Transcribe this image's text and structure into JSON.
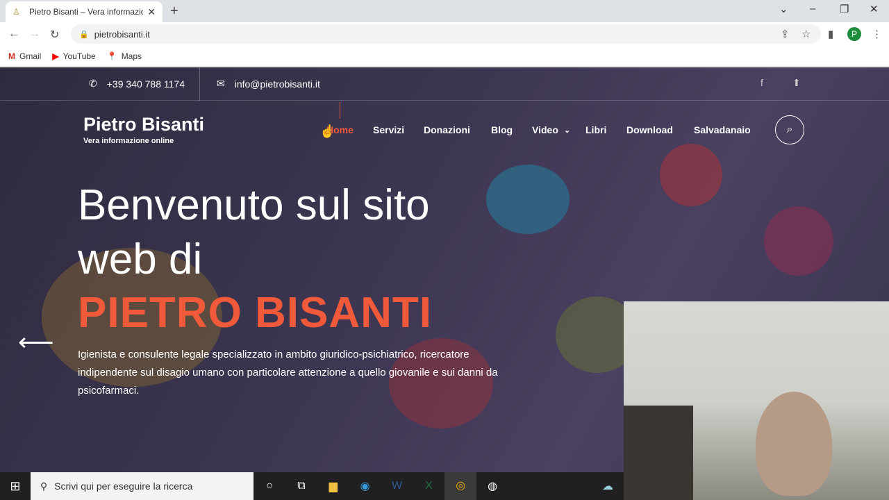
{
  "browser": {
    "tab_title": "Pietro Bisanti – Vera informazione online",
    "url": "pietrobisanti.it",
    "profile_initial": "P",
    "bookmarks": [
      "Gmail",
      "YouTube",
      "Maps"
    ]
  },
  "site": {
    "phone": "+39 340 788 1174",
    "email": "info@pietrobisanti.it",
    "logo_name": "Pietro Bisanti",
    "logo_tagline": "Vera informazione online",
    "menu": [
      "Home",
      "Servizi",
      "Donazioni",
      "Blog",
      "Video",
      "Libri",
      "Download",
      "Salvadanaio"
    ],
    "hero_line1": "Benvenuto sul sito",
    "hero_line2": "web di",
    "hero_name": "PIETRO BISANTI",
    "hero_desc": "Igienista e consulente legale specializzato in ambito giuridico-psichiatrico, ricercatore indipendente sul disagio umano con particolare attenzione a quello giovanile e sui danni da psicofarmaci.",
    "accent": "#f05a3a"
  },
  "taskbar": {
    "search_placeholder": "Scrivi qui per eseguire la ricerca"
  }
}
